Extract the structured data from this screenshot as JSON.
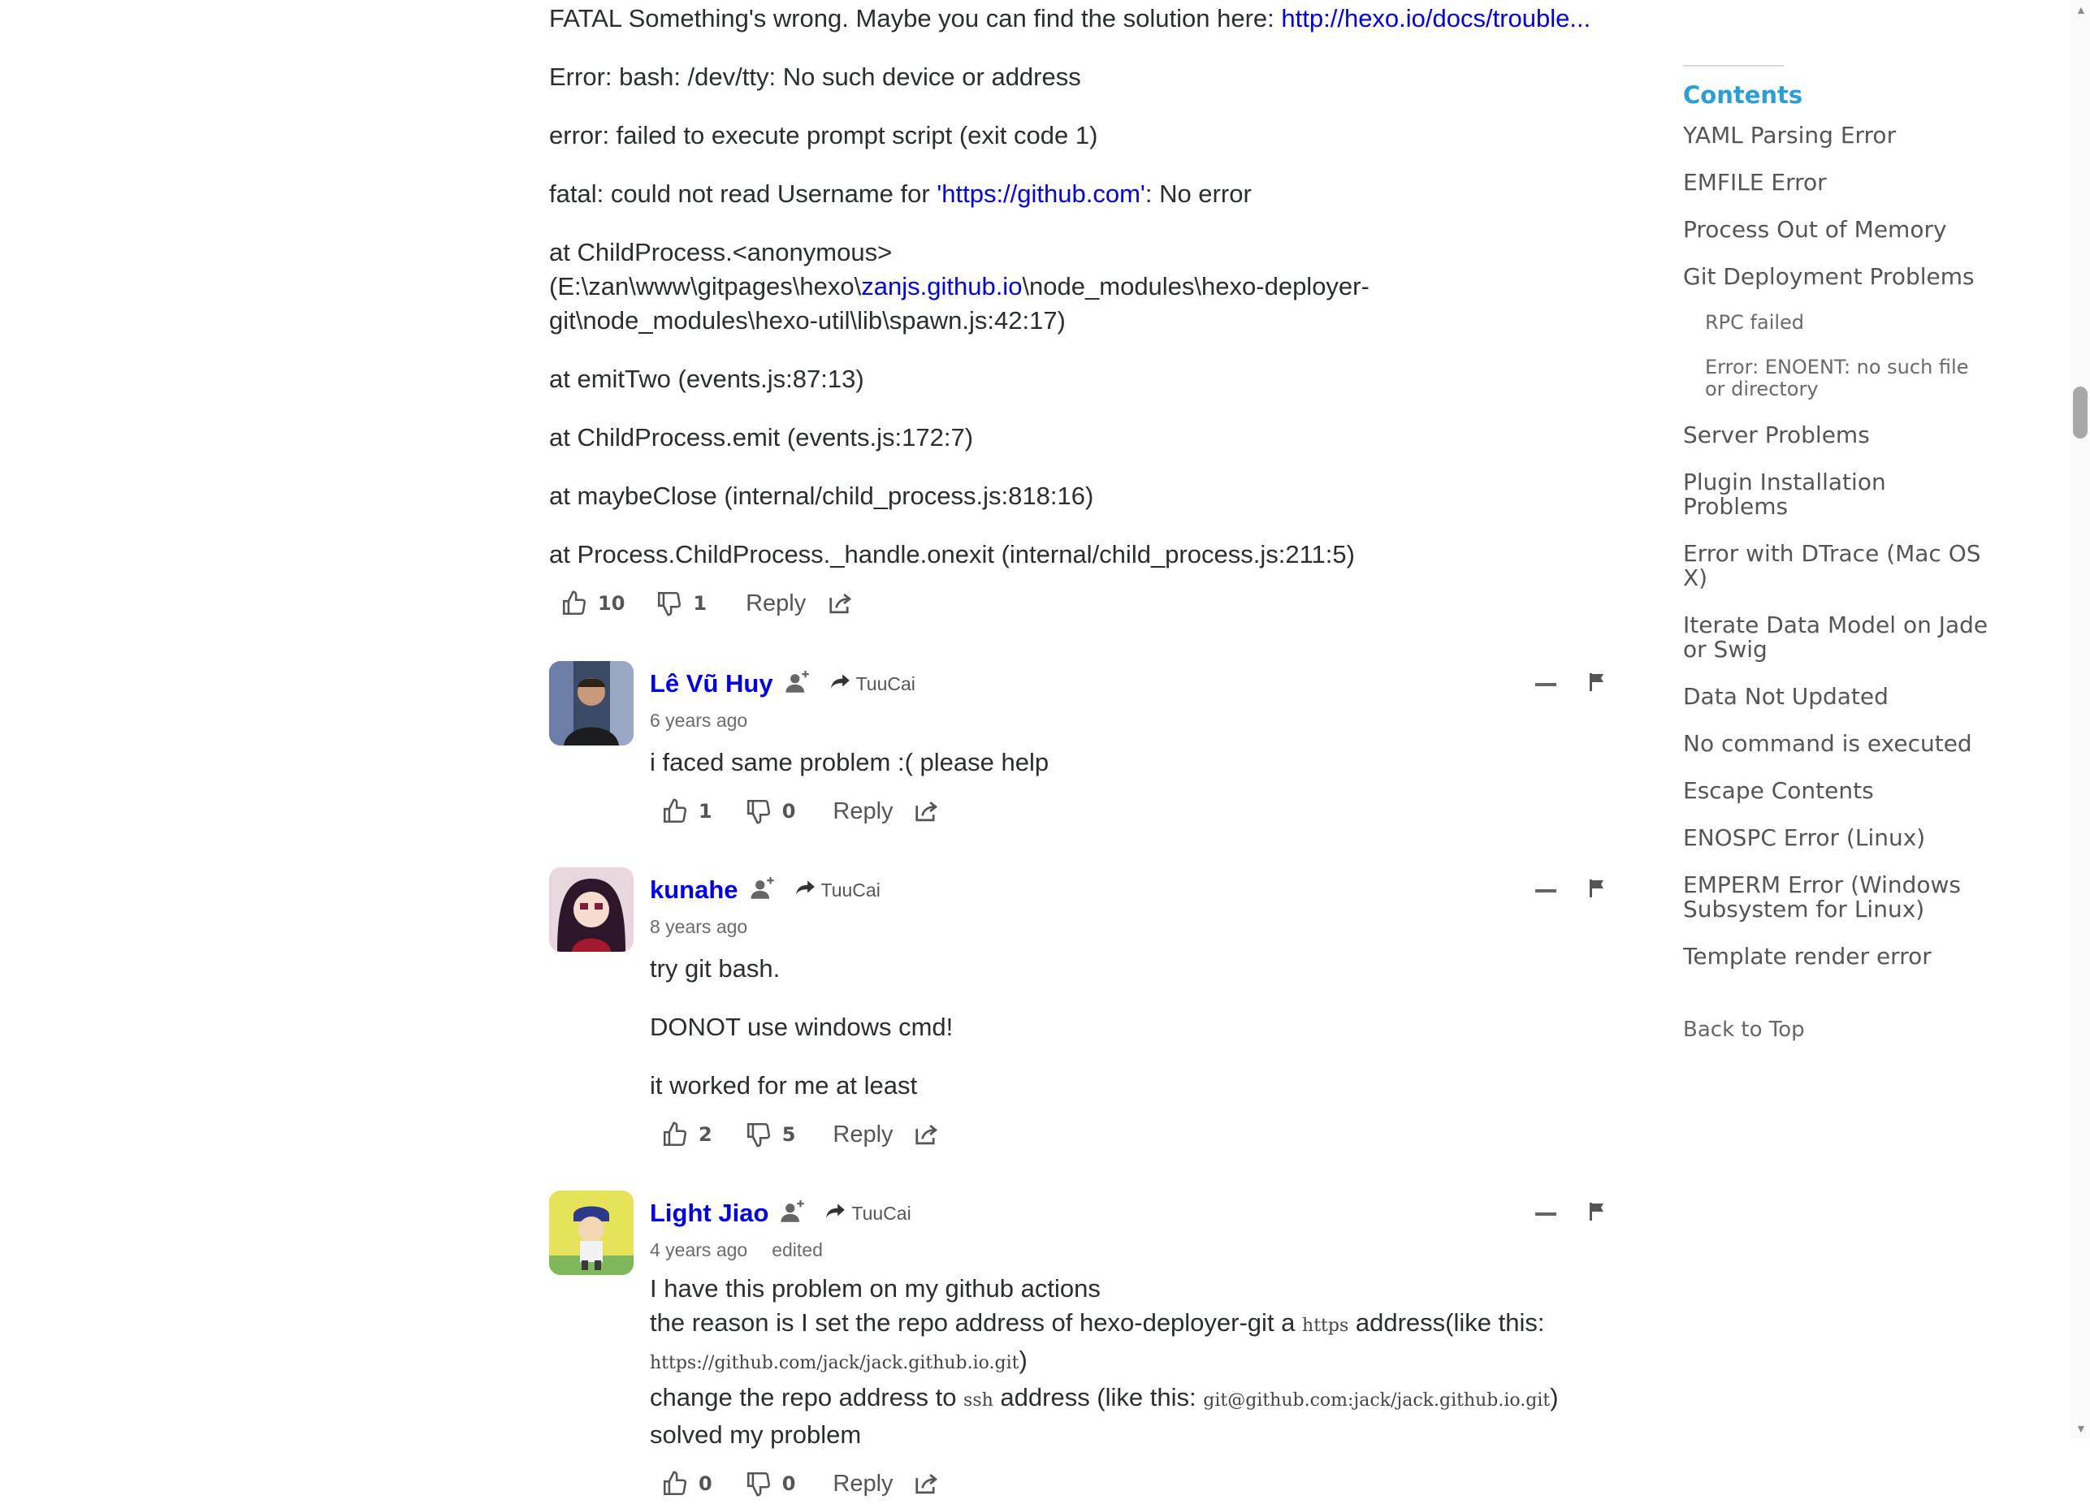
{
  "main_comment": {
    "lines": [
      {
        "text": "FATAL Something's wrong. Maybe you can find the solution here: ",
        "link": "http://hexo.io/docs/trouble..."
      },
      {
        "text": "Error: bash: /dev/tty: No such device or address"
      },
      {
        "text": "error: failed to execute prompt script (exit code 1)"
      },
      {
        "pre": "fatal: could not read Username for ",
        "link": "'https://github.com'",
        "post": ": No error"
      },
      {
        "pre": "at ChildProcess.<anonymous> (E:\\zan\\www\\gitpages\\hexo\\",
        "link": "zanjs.github.io",
        "post": "\\node_modules\\hexo-deployer-git\\node_modules\\hexo-util\\lib\\spawn.js:42:17)"
      },
      {
        "text": "at emitTwo (events.js:87:13)"
      },
      {
        "text": "at ChildProcess.emit (events.js:172:7)"
      },
      {
        "text": "at maybeClose (internal/child_process.js:818:16)"
      },
      {
        "text": "at Process.ChildProcess._handle.onexit (internal/child_process.js:211:5)"
      }
    ],
    "upvotes": "10",
    "downvotes": "1",
    "reply_label": "Reply"
  },
  "replies": [
    {
      "author": "Lê Vũ Huy",
      "via": "TuuCai",
      "time": "6 years ago",
      "edited": "",
      "paragraphs": [
        "i faced same problem :( please help"
      ],
      "upvotes": "1",
      "downvotes": "0",
      "reply_label": "Reply"
    },
    {
      "author": "kunahe",
      "via": "TuuCai",
      "time": "8 years ago",
      "edited": "",
      "paragraphs": [
        "try git bash.",
        "DONOT use windows cmd!",
        "it worked for me at least"
      ],
      "upvotes": "2",
      "downvotes": "5",
      "reply_label": "Reply"
    },
    {
      "author": "Light Jiao",
      "via": "TuuCai",
      "time": "4 years ago",
      "edited": "edited",
      "line1": "I have this problem on my github actions",
      "line2_pre": "the reason is I set the repo address of hexo-deployer-git a ",
      "line2_code": "https",
      "line2_post": " address(like this:",
      "line3_code": "https://github.com/jack/jack.github.io.git",
      "line3_post": ")",
      "line4_pre": "change the repo address to ",
      "line4_code": "ssh",
      "line4_mid": " address (like this: ",
      "line4_code2": "git@github.com:jack/jack.github.io.git",
      "line4_post": ")",
      "line5": "solved my problem",
      "upvotes": "0",
      "downvotes": "0",
      "reply_label": "Reply"
    }
  ],
  "toc": {
    "title": "Contents",
    "items": [
      {
        "label": "YAML Parsing Error",
        "sub": false
      },
      {
        "label": "EMFILE Error",
        "sub": false
      },
      {
        "label": "Process Out of Memory",
        "sub": false
      },
      {
        "label": "Git Deployment Problems",
        "sub": false
      },
      {
        "label": "RPC failed",
        "sub": true
      },
      {
        "label": "Error: ENOENT: no such file or directory",
        "sub": true
      },
      {
        "label": "Server Problems",
        "sub": false
      },
      {
        "label": "Plugin Installation Problems",
        "sub": false
      },
      {
        "label": "Error with DTrace (Mac OS X)",
        "sub": false
      },
      {
        "label": "Iterate Data Model on Jade or Swig",
        "sub": false
      },
      {
        "label": "Data Not Updated",
        "sub": false
      },
      {
        "label": "No command is executed",
        "sub": false
      },
      {
        "label": "Escape Contents",
        "sub": false
      },
      {
        "label": "ENOSPC Error (Linux)",
        "sub": false
      },
      {
        "label": "EMPERM Error (Windows Subsystem for Linux)",
        "sub": false
      },
      {
        "label": "Template render error",
        "sub": false
      }
    ],
    "back_to_top": "Back to Top"
  },
  "icons": {
    "upvote": "thumbs-up-icon",
    "downvote": "thumbs-down-icon",
    "share": "share-icon",
    "follow": "add-user-icon",
    "via": "arrow-forward-icon",
    "collapse": "minus-icon",
    "flag": "flag-icon"
  },
  "colors": {
    "link": "#0000ee",
    "toc_title": "#2a9fd6",
    "text": "#2a2e2e"
  }
}
